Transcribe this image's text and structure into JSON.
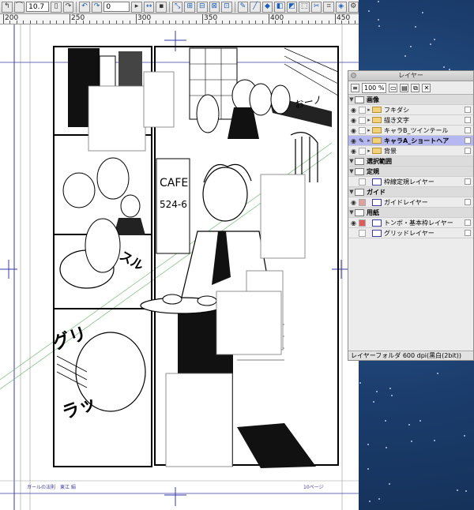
{
  "toolbar": {
    "brush_size": "10.7",
    "rotation": "0"
  },
  "ruler": {
    "labels": [
      "200",
      "250",
      "300",
      "350",
      "400",
      "450"
    ]
  },
  "canvas": {
    "footer_left": "ガールの法則　東江 絹",
    "footer_right": "10ページ",
    "sfx_right": "おーノ",
    "sfx_left_1": "スル",
    "sfx_left_2": "グリ",
    "sfx_left_3": "ラッ",
    "cafe_sign": "CAFE",
    "cafe_number": "524-6"
  },
  "layer_panel": {
    "title": "レイヤー",
    "zoom": "100 %",
    "groups": [
      {
        "name": "画像",
        "expanded": true
      },
      {
        "name": "選択範囲",
        "expanded": true
      },
      {
        "name": "定規",
        "expanded": true
      },
      {
        "name": "ガイド",
        "expanded": true
      },
      {
        "name": "用紙",
        "expanded": true
      }
    ],
    "layers": [
      {
        "name": "フキダシ",
        "selected": false
      },
      {
        "name": "描き文字",
        "selected": false
      },
      {
        "name": "キャラB_ツインテール",
        "selected": false
      },
      {
        "name": "キャラA_ショートヘア",
        "selected": true
      },
      {
        "name": "背景",
        "selected": false
      },
      {
        "name": "枠線定規レイヤー",
        "selected": false
      },
      {
        "name": "ガイドレイヤー",
        "selected": false
      },
      {
        "name": "トンボ・基本枠レイヤー",
        "selected": false
      },
      {
        "name": "グリッドレイヤー",
        "selected": false
      }
    ],
    "status": "レイヤーフォルダ 600 dpi(黒白(2bit))"
  },
  "colors": {
    "selected_layer": "#b5b8f0",
    "guide": "#3a3aa8",
    "folder": "#f1d27a"
  }
}
